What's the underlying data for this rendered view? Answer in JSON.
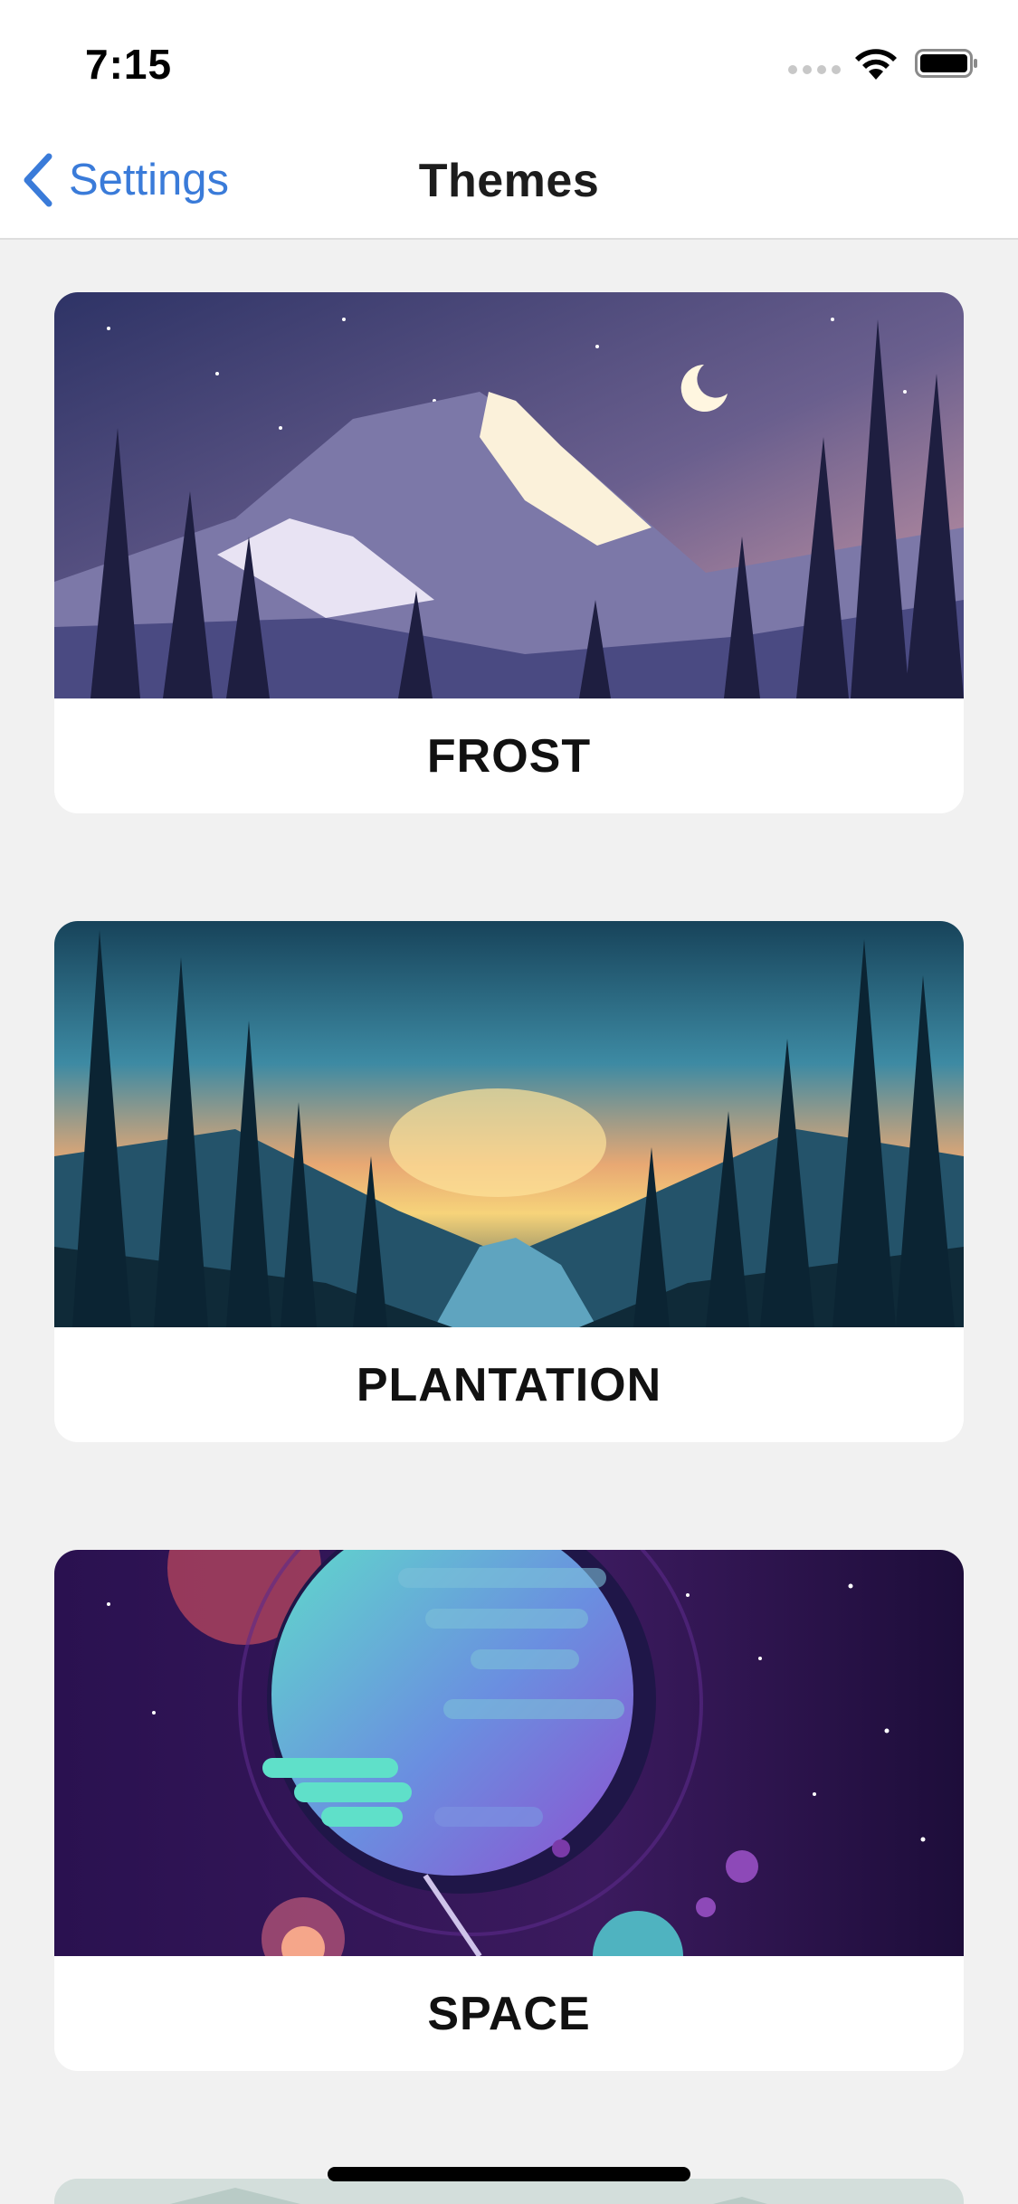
{
  "status_bar": {
    "time": "7:15",
    "icons": [
      "cellular-signal-icon",
      "wifi-icon",
      "battery-icon"
    ]
  },
  "nav": {
    "back_label": "Settings",
    "title": "Themes"
  },
  "themes": [
    {
      "label": "FROST",
      "image": "frost-mountain-illustration"
    },
    {
      "label": "PLANTATION",
      "image": "plantation-forest-illustration"
    },
    {
      "label": "SPACE",
      "image": "space-planet-illustration"
    }
  ],
  "colors": {
    "accent": "#3a7bd9",
    "background": "#f1f1f1",
    "card": "#ffffff"
  }
}
